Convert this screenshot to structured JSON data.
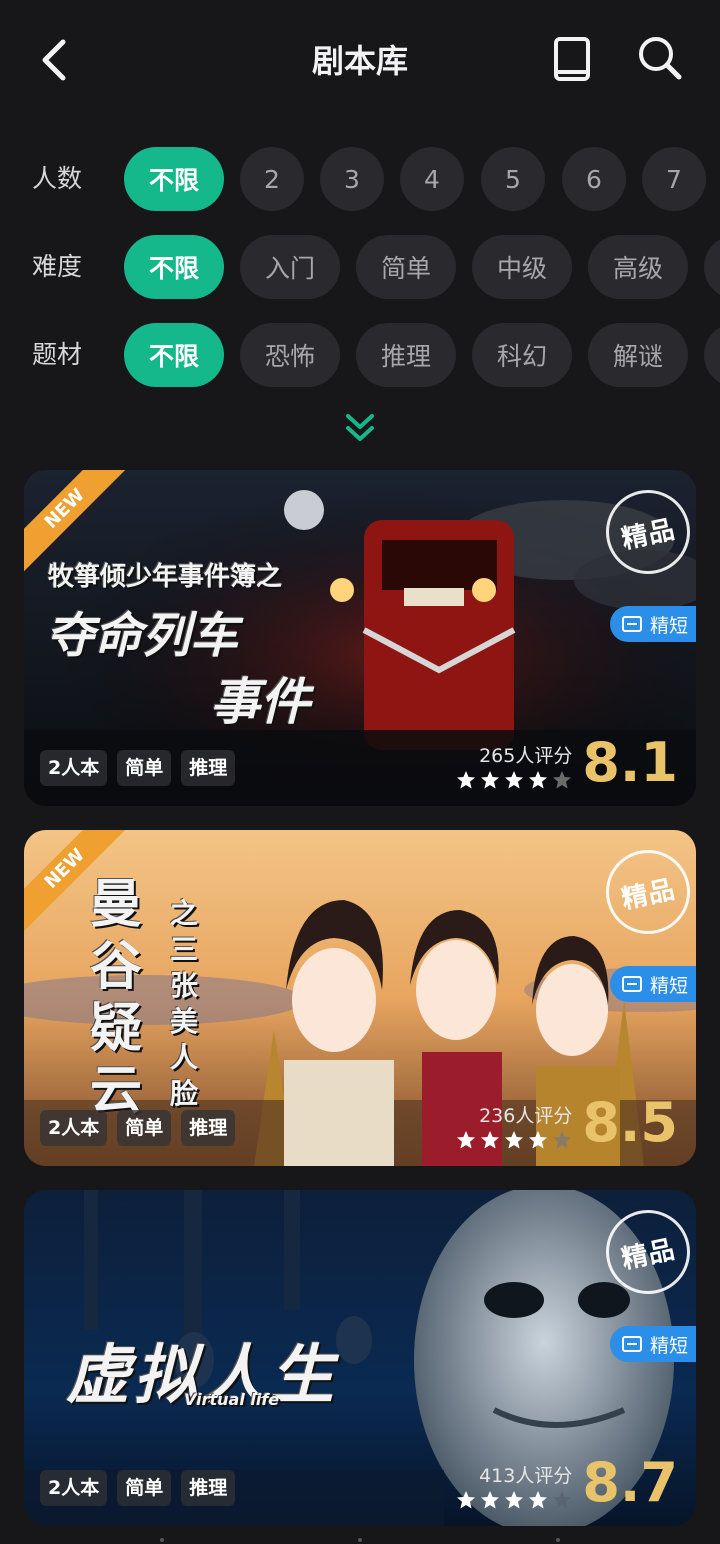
{
  "header": {
    "title": "剧本库",
    "back_icon": "chevron-left-icon",
    "book_icon": "book-icon",
    "search_icon": "search-icon"
  },
  "filters": {
    "players": {
      "label": "人数",
      "options": [
        "不限",
        "2",
        "3",
        "4",
        "5",
        "6",
        "7"
      ],
      "selected": "不限"
    },
    "difficulty": {
      "label": "难度",
      "options": [
        "不限",
        "入门",
        "简单",
        "中级",
        "高级"
      ],
      "selected": "不限"
    },
    "theme": {
      "label": "题材",
      "options": [
        "不限",
        "恐怖",
        "推理",
        "科幻",
        "解谜"
      ],
      "selected": "不限"
    },
    "expand_icon": "double-chevron-down-icon"
  },
  "colors": {
    "accent": "#14b88a",
    "score": "#e9c36a",
    "badge": "#2b8ee8",
    "ribbon": "#f0a030"
  },
  "cards": [
    {
      "new_label": "NEW",
      "premium_label": "精品",
      "short_label": "精短",
      "subtitle": "牧箏倾少年事件簿之",
      "title_line1": "夺命列车",
      "title_line2": "事件",
      "tags": [
        "2人本",
        "简单",
        "推理"
      ],
      "rating_count": "265人评分",
      "stars": 4,
      "score": "8.1"
    },
    {
      "new_label": "NEW",
      "premium_label": "精品",
      "short_label": "精短",
      "title_main": "曼谷疑云",
      "title_sub": "之三张美人脸",
      "tags": [
        "2人本",
        "简单",
        "推理"
      ],
      "rating_count": "236人评分",
      "stars": 4,
      "score": "8.5"
    },
    {
      "premium_label": "精品",
      "short_label": "精短",
      "title_main": "虚拟人生",
      "title_en": "Virtual life",
      "tags": [
        "2人本",
        "简单",
        "推理"
      ],
      "rating_count": "413人评分",
      "stars": 4,
      "score": "8.7"
    }
  ]
}
